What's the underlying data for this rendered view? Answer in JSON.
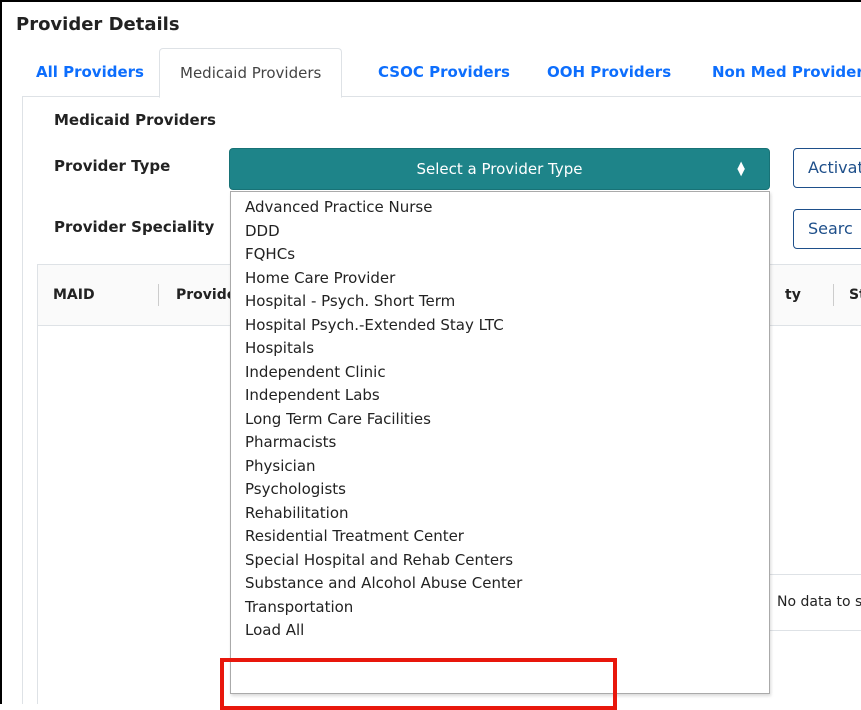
{
  "header": {
    "title": "Provider Details"
  },
  "tabs": [
    {
      "label": "All Providers"
    },
    {
      "label": "Medicaid Providers"
    },
    {
      "label": "CSOC Providers"
    },
    {
      "label": "OOH Providers"
    },
    {
      "label": "Non Med Provider"
    }
  ],
  "section": {
    "title": "Medicaid Providers"
  },
  "form": {
    "provider_type_label": "Provider Type",
    "provider_type_selected": "Select a Provider Type",
    "provider_speciality_label": "Provider Speciality",
    "activate_button": "Activat",
    "search_button": "Searc"
  },
  "dropdown": {
    "options": [
      "Advanced Practice Nurse",
      "DDD",
      "FQHCs",
      "Home Care Provider",
      "Hospital - Psych. Short Term",
      "Hospital Psych.-Extended Stay LTC",
      "Hospitals",
      "Independent Clinic",
      "Independent Labs",
      "Long Term Care Facilities",
      "Pharmacists",
      "Physician",
      "Psychologists",
      "Rehabilitation",
      "Residential Treatment Center",
      "Special Hospital and Rehab Centers",
      "Substance and Alcohol Abuse Center",
      "Transportation",
      "Load All"
    ]
  },
  "table": {
    "columns": [
      "MAID",
      "Provide",
      "ty",
      "St"
    ],
    "empty_text": "No data to s"
  },
  "colors": {
    "select_bg": "#1e8489",
    "link": "#0d6efd",
    "highlight": "#e8170c"
  }
}
